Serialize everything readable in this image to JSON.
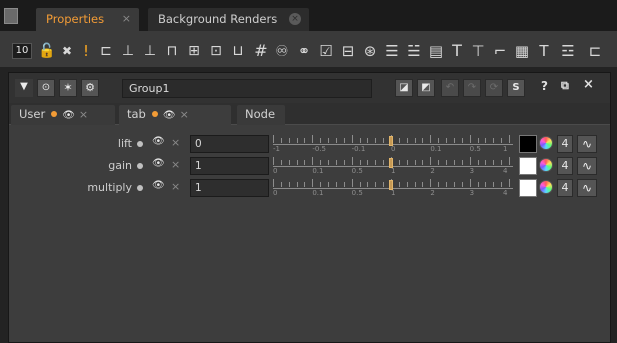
{
  "panel_tabs": {
    "active": {
      "label": "Properties",
      "close": "×"
    },
    "inactive": {
      "label": "Background Renders",
      "close": "×"
    }
  },
  "toolbar": {
    "count": "10",
    "icons": [
      "lock-icon",
      "close-all-icon",
      "float-icon",
      "node-tool-icon",
      "grid-icon",
      "grid-icon",
      "region-icon",
      "region-icon",
      "link-icon",
      "hash-icon",
      "nodes-icon",
      "nodes-icon",
      "checkbox-icon",
      "button-icon",
      "transform-icon",
      "list-icon",
      "list-icon",
      "text-icon",
      "text-icon",
      "paste-icon",
      "tab-icon",
      "divider-icon",
      "divider-icon"
    ]
  },
  "node_panel": {
    "name": "Group1",
    "header_buttons": {
      "collapse": "▼",
      "center": "⊙",
      "settings": "S",
      "help": "?",
      "float": "⧉",
      "close": "×"
    },
    "tabs": [
      {
        "label": "User",
        "dot_color": "#f39c36"
      },
      {
        "label": "tab",
        "dot_color": "#f39c36"
      },
      {
        "label": "Node"
      }
    ],
    "knobs": [
      {
        "label": "lift",
        "value": "0",
        "swatch": "#000000",
        "channels": "4",
        "slider_ticks": [
          "-1",
          "-0.5",
          "-0.1",
          "0",
          "0.1",
          "0.5",
          "1"
        ],
        "handle_value": 0
      },
      {
        "label": "gain",
        "value": "1",
        "swatch": "#ffffff",
        "channels": "4",
        "slider_ticks": [
          "0",
          "0.1",
          "0.5",
          "1",
          "2",
          "3",
          "4"
        ],
        "handle_value": 1
      },
      {
        "label": "multiply",
        "value": "1",
        "swatch": "#ffffff",
        "channels": "4",
        "slider_ticks": [
          "0",
          "0.1",
          "0.5",
          "1",
          "2",
          "3",
          "4"
        ],
        "handle_value": 1
      }
    ]
  },
  "colors": {
    "accent": "#f39c36",
    "panel": "#3d3d3d",
    "background": "#232323"
  }
}
